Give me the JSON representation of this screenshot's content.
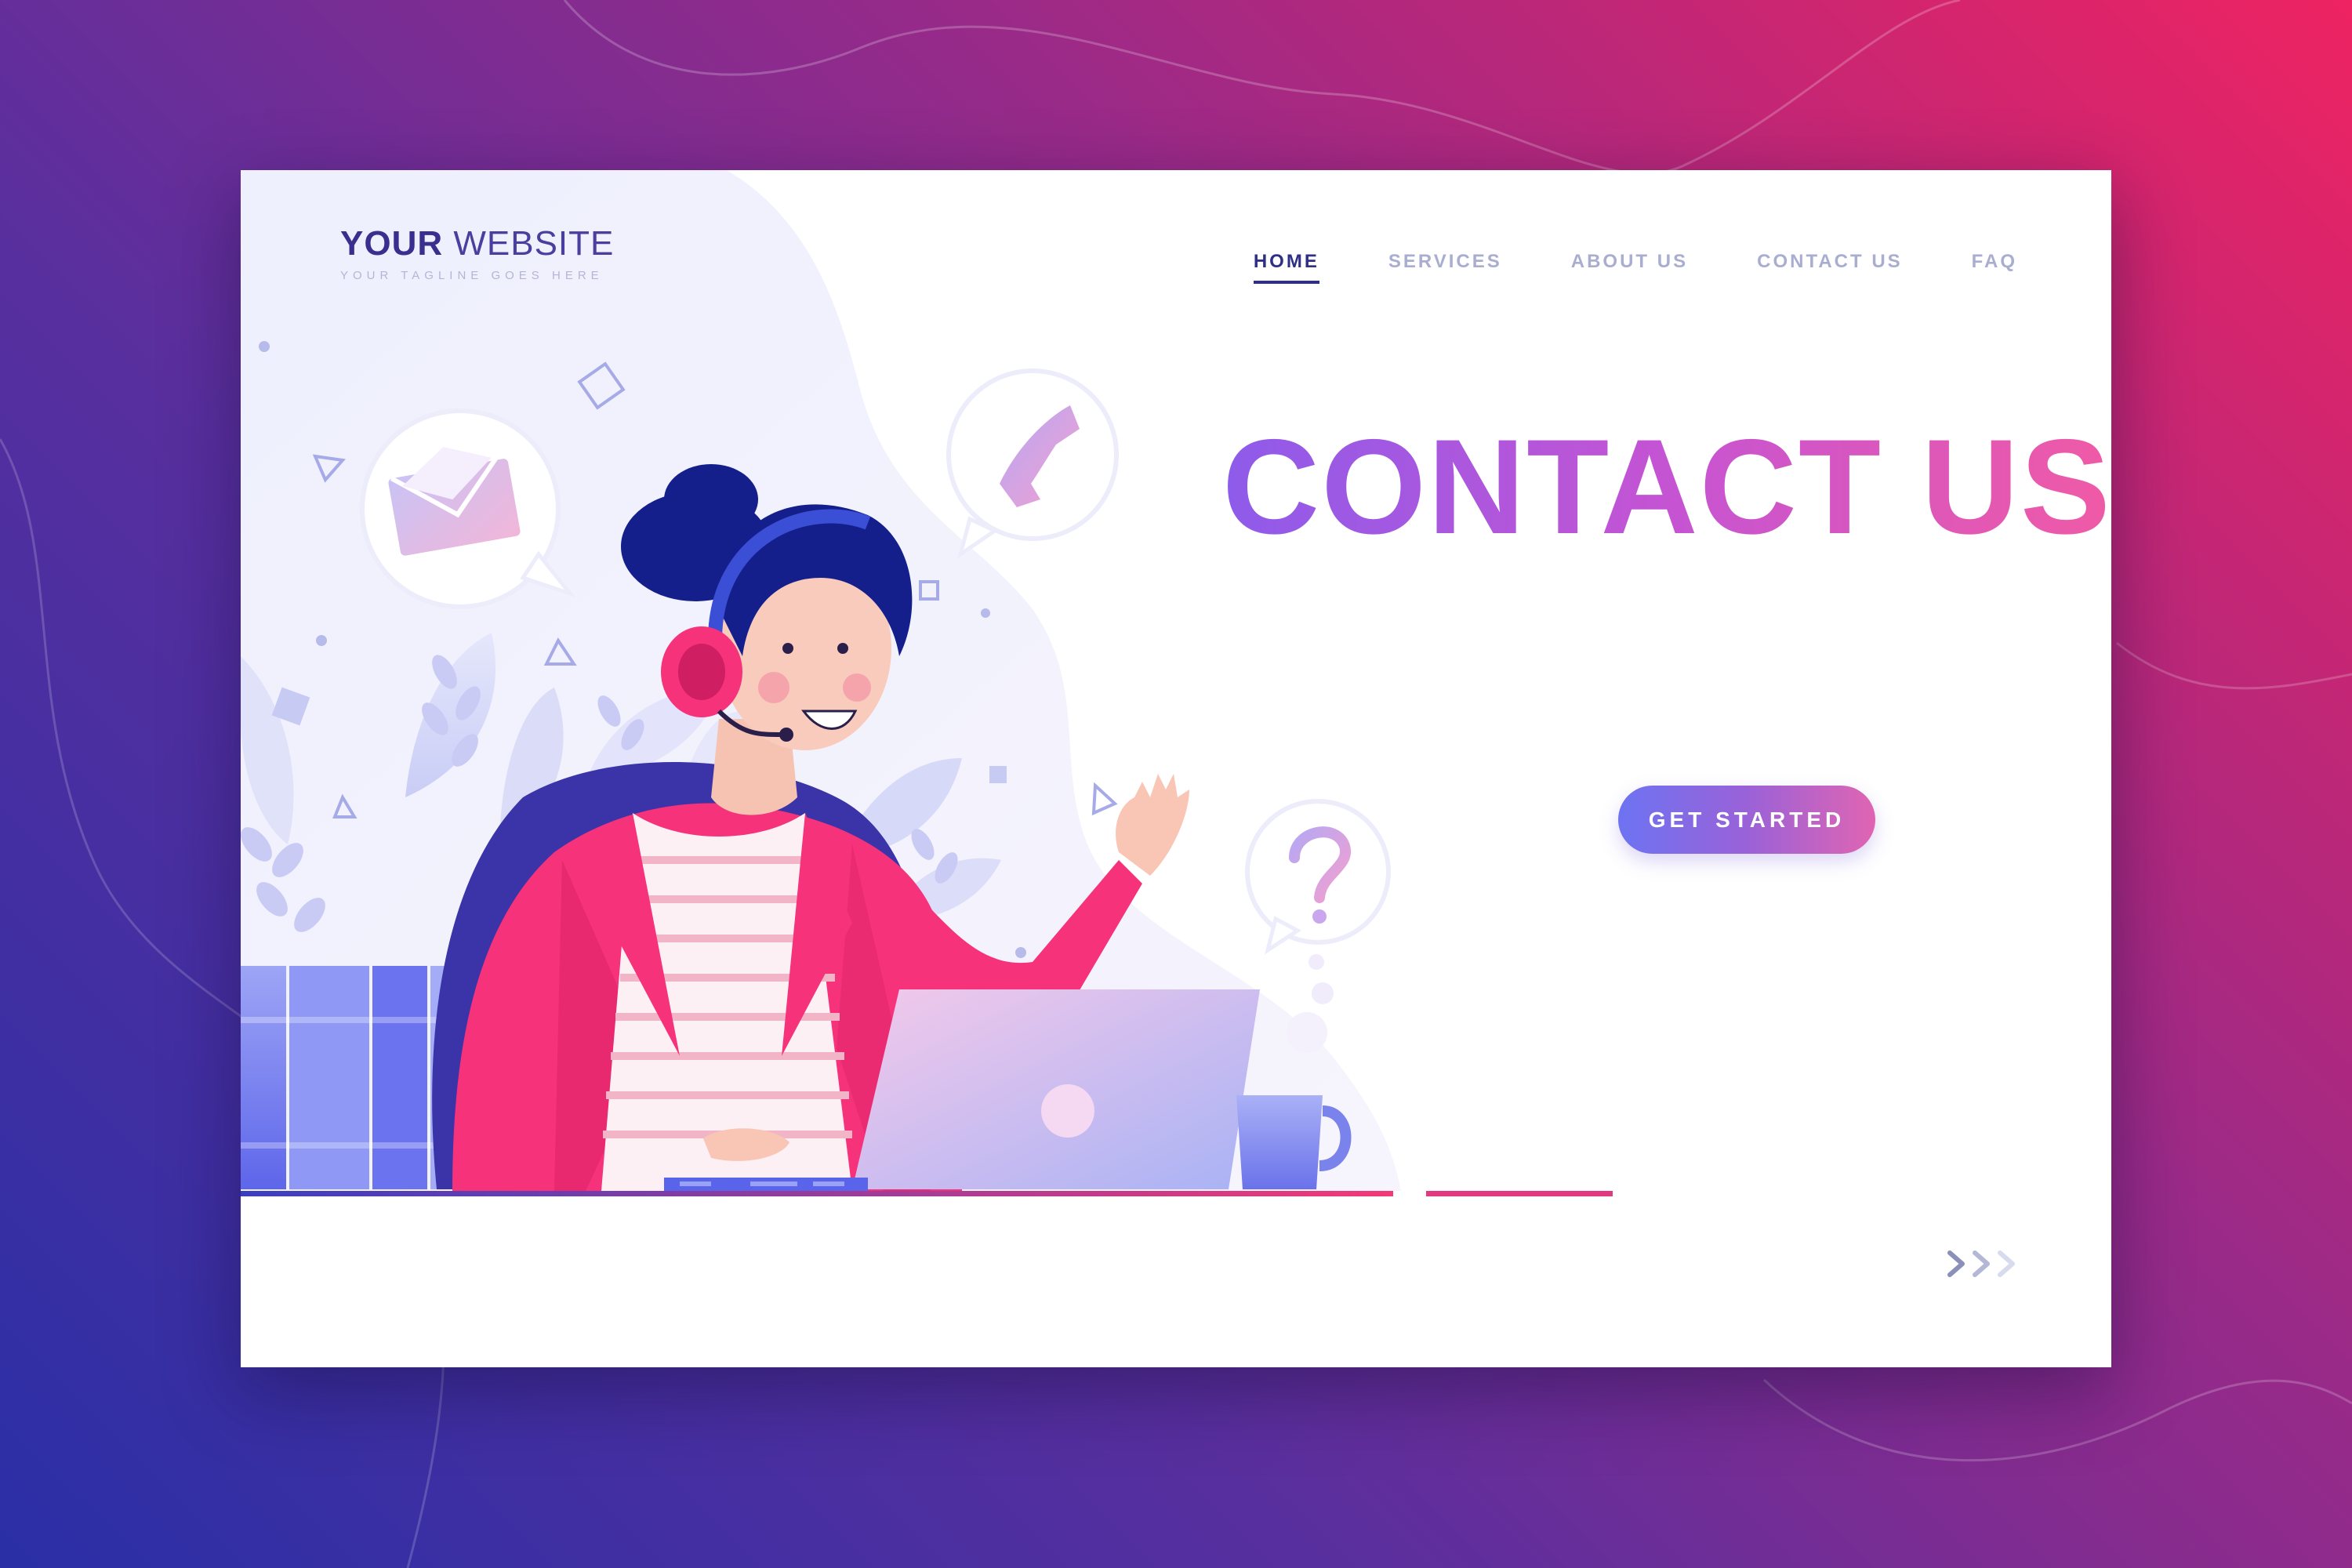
{
  "logo": {
    "title_bold": "YOUR",
    "title_light": " WEBSITE",
    "tagline": "YOUR TAGLINE GOES HERE"
  },
  "nav": {
    "items": [
      {
        "label": "HOME",
        "active": true
      },
      {
        "label": "SERVICES",
        "active": false
      },
      {
        "label": "ABOUT US",
        "active": false
      },
      {
        "label": "CONTACT US",
        "active": false
      },
      {
        "label": "FAQ",
        "active": false
      }
    ]
  },
  "hero": {
    "title": "CONTACT US",
    "cta_label": "GET STARTED"
  },
  "icons": [
    "envelope-icon",
    "phone-icon",
    "question-mark-icon",
    "chevron-right-icon"
  ],
  "colors": {
    "background_start": "#2a2fa6",
    "background_end": "#ee2362",
    "nav_active": "#2e2f85",
    "nav_inactive": "#a9aed1",
    "title_gradient_start": "#8e5bea",
    "title_gradient_end": "#f05aa6",
    "jacket": "#f5327a",
    "hair": "#141f8c"
  }
}
